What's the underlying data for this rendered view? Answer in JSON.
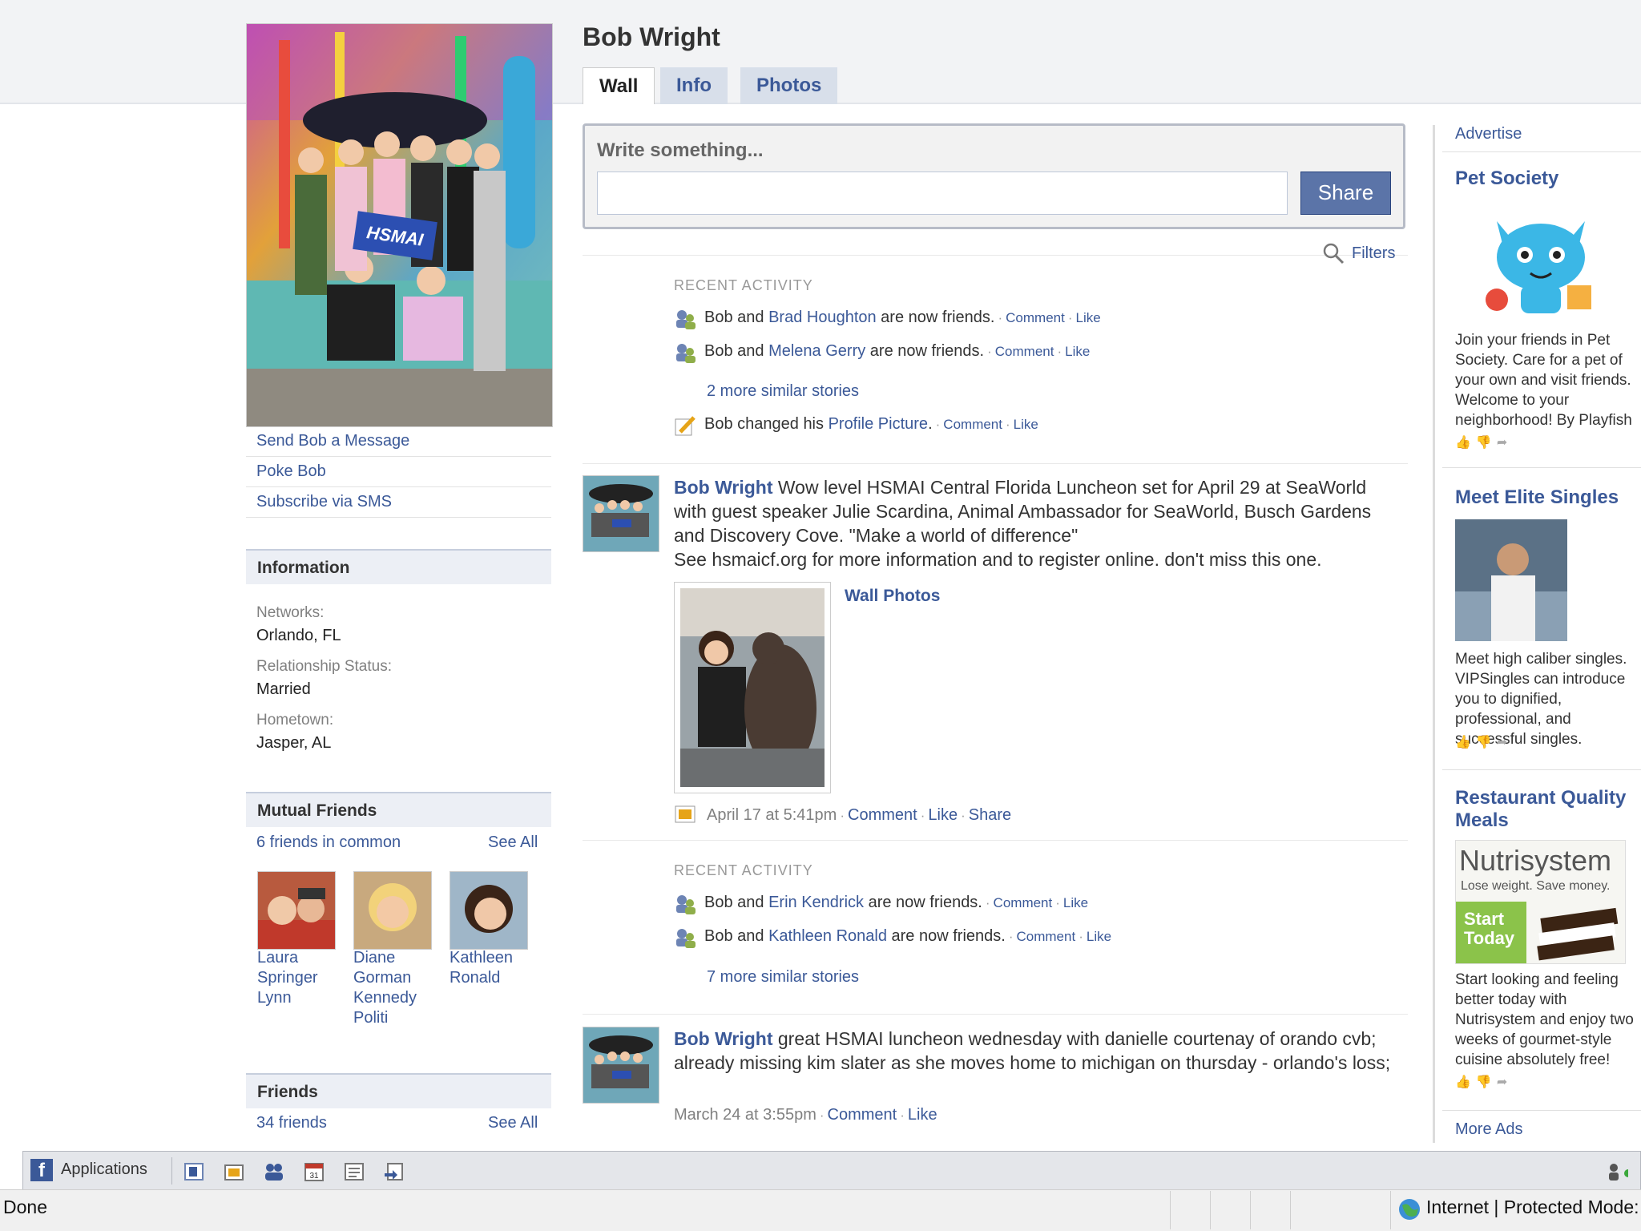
{
  "profile": {
    "name": "Bob Wright",
    "banner_text": "HSMAI",
    "links": [
      "Send Bob a Message",
      "Poke Bob",
      "Subscribe via SMS"
    ]
  },
  "tabs": [
    {
      "label": "Wall",
      "active": true
    },
    {
      "label": "Info",
      "active": false
    },
    {
      "label": "Photos",
      "active": false
    }
  ],
  "information": {
    "header": "Information",
    "fields": [
      {
        "label": "Networks:",
        "value": "Orlando, FL"
      },
      {
        "label": "Relationship Status:",
        "value": "Married"
      },
      {
        "label": "Hometown:",
        "value": "Jasper, AL"
      }
    ]
  },
  "mutual_friends": {
    "header": "Mutual Friends",
    "count_text": "6 friends in common",
    "see_all": "See All",
    "people": [
      {
        "name": "Laura Springer Lynn"
      },
      {
        "name": "Diane Gorman Kennedy Politi"
      },
      {
        "name": "Kathleen Ronald"
      }
    ]
  },
  "friends": {
    "header": "Friends",
    "count_text": "34 friends",
    "see_all": "See All"
  },
  "composer": {
    "prompt": "Write something...",
    "input_value": "",
    "share_label": "Share"
  },
  "filters_label": "Filters",
  "feed": {
    "recent_activity_1": {
      "heading": "RECENT ACTIVITY",
      "l1_pre": "Bob and ",
      "l1_name": "Brad Houghton",
      "l1_post": " are now friends.",
      "l2_pre": "Bob and ",
      "l2_name": "Melena Gerry",
      "l2_post": " are now friends.",
      "more": "2 more similar stories",
      "l3_pre": "Bob changed his ",
      "l3_name": "Profile Picture",
      "l3_post": "."
    },
    "post_1": {
      "author": "Bob Wright",
      "text": " Wow level HSMAI Central Florida Luncheon set for April 29 at SeaWorld with guest speaker Julie Scardina, Animal Ambassador for SeaWorld, Busch Gardens and Discovery Cove. \"Make a world of difference\"",
      "text2": "See hsmaicf.org for more information and to register online. don't miss this one.",
      "album": "Wall Photos",
      "time": "April 17 at 5:41pm",
      "actions": [
        "Comment",
        "Like",
        "Share"
      ]
    },
    "recent_activity_2": {
      "heading": "RECENT ACTIVITY",
      "l1_pre": "Bob and ",
      "l1_name": "Erin Kendrick",
      "l1_post": " are now friends.",
      "l2_pre": "Bob and ",
      "l2_name": "Kathleen Ronald",
      "l2_post": " are now friends.",
      "more": "7 more similar stories"
    },
    "post_2": {
      "author": "Bob Wright",
      "text": " great HSMAI luncheon wednesday with danielle courtenay of orando cvb; already missing kim slater as she moves home to michigan on thursday - orlando's loss;",
      "time": "March 24 at 3:55pm",
      "actions": [
        "Comment",
        "Like"
      ]
    },
    "comment_label": "Comment",
    "like_label": "Like"
  },
  "ads": {
    "advertise": "Advertise",
    "items": [
      {
        "title": "Pet Society",
        "text": "Join your friends in Pet Society. Care for a pet of your own and visit friends. Welcome to your neighborhood! By Playfish"
      },
      {
        "title": "Meet Elite Singles",
        "text": "Meet high caliber singles. VIPSingles can introduce you to dignified, professional, and successful singles."
      },
      {
        "title": "Restaurant Quality Meals",
        "text": "Start looking and feeling better today with Nutrisystem and enjoy two weeks of gourmet-style cuisine absolutely free!",
        "brand": "Nutrisystem",
        "tagline": "Lose weight. Save money.",
        "cta": "Start Today"
      }
    ],
    "more_ads": "More Ads"
  },
  "fb_bar": {
    "applications": "Applications"
  },
  "status_bar": {
    "left": "Done",
    "right": "Internet | Protected Mode:"
  },
  "colors": {
    "link": "#3b5998",
    "share_button": "#5b74a8",
    "tab_inactive": "#d8dfea"
  }
}
